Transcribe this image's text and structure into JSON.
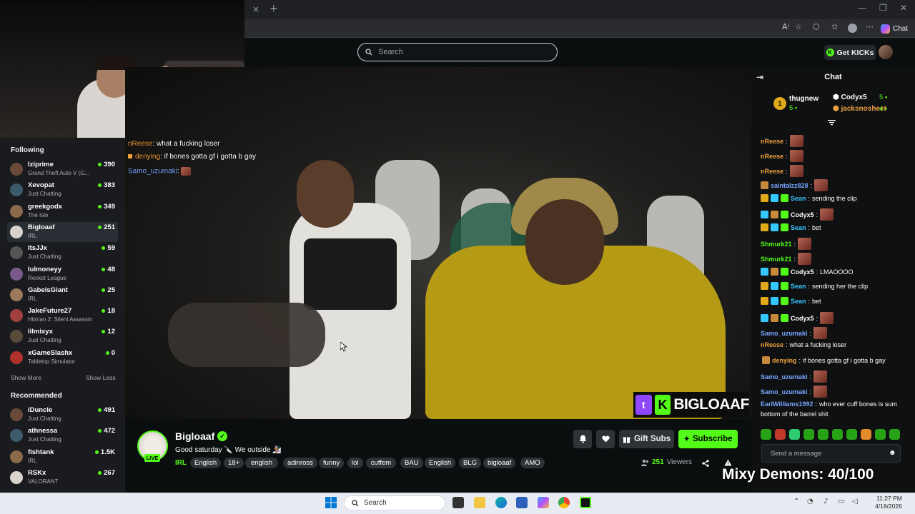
{
  "browser": {
    "new_tab": "+",
    "tab_close": "×",
    "minimize": "—",
    "restore": "❐",
    "close": "✕",
    "chat_label": "Chat"
  },
  "header": {
    "search_placeholder": "Search",
    "get_kicks": "Get KICKs"
  },
  "overlay_chat": [
    {
      "user": "nReese",
      "text": "what a fucking loser",
      "color": "#f0a040"
    },
    {
      "user": "denying",
      "text": "if bones gotta gf i gotta b gay",
      "color": "#f0a040"
    },
    {
      "user": "Samo_uzumaki",
      "text": "",
      "color": "#7aa6ff"
    }
  ],
  "sidebar": {
    "following_title": "Following",
    "following": [
      {
        "name": "Iziprime",
        "category": "Grand Theft Auto V (G...",
        "count": "390"
      },
      {
        "name": "Xevopat",
        "category": "Just Chatting",
        "count": "383"
      },
      {
        "name": "greekgodx",
        "category": "The Isle",
        "count": "349"
      },
      {
        "name": "Bigloaaf",
        "category": "IRL",
        "count": "251"
      },
      {
        "name": "ItsJJx",
        "category": "Just Chatting",
        "count": "59"
      },
      {
        "name": "lulmoneyy",
        "category": "Rocket League",
        "count": "48"
      },
      {
        "name": "GabelsGiant",
        "category": "IRL",
        "count": "25"
      },
      {
        "name": "JakeFuture27",
        "category": "Hitman 2: Silent Assassin",
        "count": "18"
      },
      {
        "name": "lilmixyx",
        "category": "Just Chatting",
        "count": "12"
      },
      {
        "name": "xGameSlashx",
        "category": "Tabletop Simulator",
        "count": "0"
      }
    ],
    "show_more": "Show More",
    "show_less": "Show Less",
    "recommended_title": "Recommended",
    "recommended": [
      {
        "name": "iDuncle",
        "category": "Just Chatting",
        "count": "491"
      },
      {
        "name": "athnessa",
        "category": "Just Chatting",
        "count": "472"
      },
      {
        "name": "fishtank",
        "category": "IRL",
        "count": "1.5K"
      },
      {
        "name": "RSKx",
        "category": "VALORANT",
        "count": "267"
      }
    ]
  },
  "video": {
    "brand_name": "BIGLOAAF"
  },
  "stream": {
    "live": "LIVE",
    "streamer": "Bigloaaf",
    "title": "Good saturday 🔪 We outside 🏂",
    "category": "IRL",
    "tags": [
      "English",
      "18+",
      "english",
      "adinross",
      "funny",
      "lol",
      "cuffem",
      "BAU",
      "English",
      "BLG",
      "bigloaaf",
      "AMO"
    ],
    "gift_subs": "Gift Subs",
    "subscribe": "Subscribe",
    "viewer_count": "251",
    "viewers_label": "Viewers"
  },
  "chat": {
    "title": "Chat",
    "leaderboard": [
      {
        "rank": "1",
        "name": "thugnew",
        "value": "5"
      },
      {
        "name": "Codyx5",
        "value": "5"
      },
      {
        "name": "jacksnosheet",
        "value": "4"
      }
    ],
    "messages": [
      {
        "user": "nReese",
        "text": "",
        "emote": true,
        "color": "#f0a040"
      },
      {
        "user": "nReese",
        "text": "",
        "emote": true,
        "color": "#f0a040"
      },
      {
        "user": "nReese",
        "text": "",
        "emote": true,
        "color": "#f0a040"
      },
      {
        "user": "saintalzz828",
        "text": "",
        "emote": true,
        "color": "#7aa6ff"
      },
      {
        "user": "Sean",
        "text": "sending the clip",
        "emote": false,
        "color": "#35c8ff"
      },
      {
        "user": "Codyx5",
        "text": "",
        "emote": true,
        "color": "#ffffff"
      },
      {
        "user": "Sean",
        "text": "bet",
        "emote": false,
        "color": "#35c8ff"
      },
      {
        "user": "Shmurk21",
        "text": "",
        "emote": true,
        "color": "#53fc18"
      },
      {
        "user": "Shmurk21",
        "text": "",
        "emote": true,
        "color": "#53fc18"
      },
      {
        "user": "Codyx5",
        "text": "LMAOOOO",
        "emote": false,
        "color": "#ffffff"
      },
      {
        "user": "Sean",
        "text": "sending her the clip",
        "emote": false,
        "color": "#35c8ff"
      },
      {
        "user": "Sean",
        "text": "bet",
        "emote": false,
        "color": "#35c8ff"
      },
      {
        "user": "Codyx5",
        "text": "",
        "emote": true,
        "color": "#ffffff"
      },
      {
        "user": "Samo_uzumaki",
        "text": "",
        "emote": true,
        "color": "#7aa6ff"
      },
      {
        "user": "nReese",
        "text": "what a fucking loser",
        "emote": false,
        "color": "#f0a040"
      },
      {
        "user": "denying",
        "text": "if bones gotta gf i gotta b gay",
        "emote": false,
        "color": "#f0a040"
      },
      {
        "user": "Samo_uzumaki",
        "text": "",
        "emote": true,
        "color": "#7aa6ff"
      },
      {
        "user": "Samo_uzumaki",
        "text": "",
        "emote": true,
        "color": "#7aa6ff"
      },
      {
        "user": "EarlWilliams1992",
        "text": "who ever cuff bones is sum",
        "emote": false,
        "color": "#7aa6ff"
      },
      {
        "user": "",
        "text": "bottom of the barrel shit",
        "emote": false,
        "color": "#ffffff"
      }
    ],
    "input_placeholder": "Send a message"
  },
  "overlay_text": "Mixy Demons: 40/100",
  "taskbar": {
    "search": "Search",
    "time": "11:27 PM",
    "date": "4/18/2026"
  },
  "colors": {
    "accent": "#53fc18",
    "background": "#0b0e0f",
    "sidebar": "#191b1f"
  }
}
